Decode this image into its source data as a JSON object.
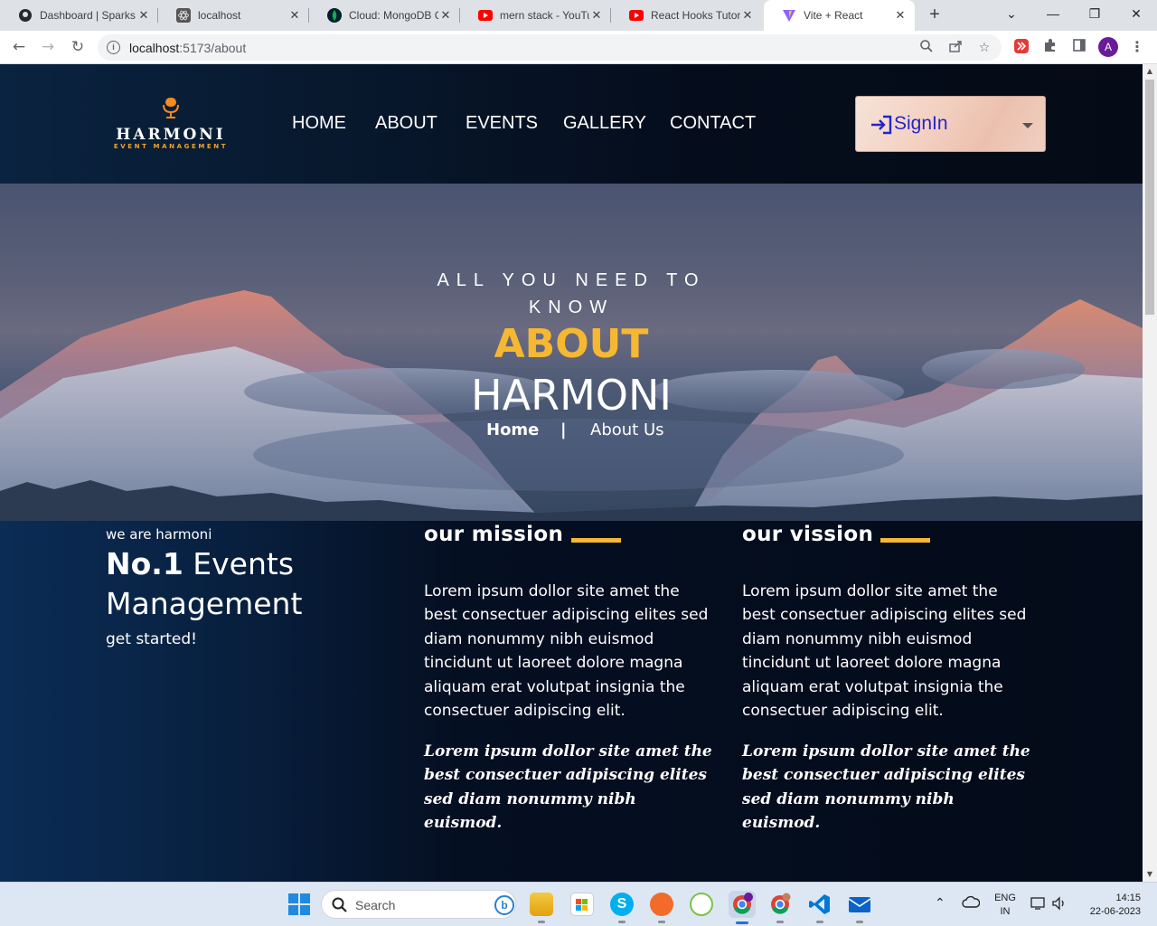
{
  "browser": {
    "tabs": [
      {
        "title": "Dashboard | Sparks",
        "favicon": "github-icon"
      },
      {
        "title": "localhost",
        "favicon": "react-icon"
      },
      {
        "title": "Cloud: MongoDB C",
        "favicon": "mongodb-leaf-icon"
      },
      {
        "title": "mern stack - YouTu",
        "favicon": "youtube-icon"
      },
      {
        "title": "React Hooks Tutori",
        "favicon": "youtube-icon"
      },
      {
        "title": "Vite + React",
        "favicon": "vite-icon",
        "active": true
      }
    ],
    "url_host": "localhost",
    "url_path": ":5173/about",
    "profile_initial": "A"
  },
  "site": {
    "logo": {
      "brand": "HARMONI",
      "tagline": "EVENT MANAGEMENT"
    },
    "nav": [
      "HOME",
      "ABOUT",
      "EVENTS",
      "GALLERY",
      "CONTACT"
    ],
    "signin_label": "SignIn"
  },
  "hero": {
    "kicker": "ALL YOU NEED TO KNOW",
    "title_accent": "ABOUT",
    "title_main": "HARMONI",
    "breadcrumb": {
      "home": "Home",
      "separator": "|",
      "current": "About Us"
    }
  },
  "intro": {
    "small": "we are harmoni",
    "title_num": "No.1",
    "title_rest": " Events Management",
    "cta": "get started!"
  },
  "columns": [
    {
      "heading": "our mission",
      "body": "Lorem ipsum dollor site amet the best consectuer adipiscing elites sed diam nonummy nibh euismod tincidunt ut laoreet dolore magna aliquam erat volutpat insignia the consectuer adipiscing elit.",
      "emphasis": "Lorem ipsum dollor site amet the best consectuer adipiscing elites sed diam nonummy nibh euismod."
    },
    {
      "heading": "our vission",
      "body": "Lorem ipsum dollor site amet the best consectuer adipiscing elites sed diam nonummy nibh euismod tincidunt ut laoreet dolore magna aliquam erat volutpat insignia the consectuer adipiscing elit.",
      "emphasis": "Lorem ipsum dollor site amet the best consectuer adipiscing elites sed diam nonummy nibh euismod."
    }
  ],
  "taskbar": {
    "search_placeholder": "Search",
    "lang_line1": "ENG",
    "lang_line2": "IN",
    "time": "14:15",
    "date": "22-06-2023"
  },
  "colors": {
    "accent": "#f6b832",
    "signin_text": "#2424c8",
    "page_bg": "#050d1c"
  }
}
